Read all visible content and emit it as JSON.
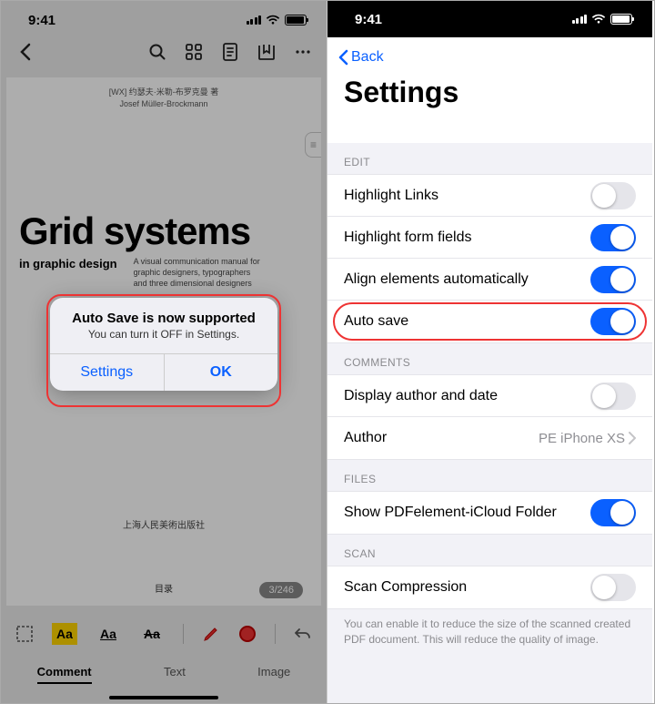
{
  "status_time": "9:41",
  "left": {
    "doc": {
      "meta_line1": "[WX] 约瑟夫·米勒-布罗克曼 著",
      "meta_line2": "Josef Müller-Brockmann",
      "title": "Grid systems",
      "subtitle": "in graphic design",
      "desc": "A visual communication manual for graphic designers, typographers and three dimensional designers",
      "footer": "上海人民美術出版社",
      "toc": "目录",
      "page_indicator": "3/246"
    },
    "tools": {
      "aa": "Aa"
    },
    "tabs": {
      "comment": "Comment",
      "text": "Text",
      "image": "Image"
    },
    "dialog": {
      "title": "Auto Save is now supported",
      "message": "You can turn it OFF in Settings.",
      "settings": "Settings",
      "ok": "OK"
    }
  },
  "right": {
    "back": "Back",
    "title": "Settings",
    "sections": {
      "edit": "EDIT",
      "comments": "COMMENTS",
      "files": "FILES",
      "scan": "SCAN"
    },
    "rows": {
      "highlight_links": "Highlight Links",
      "highlight_form": "Highlight form fields",
      "align": "Align elements automatically",
      "auto_save": "Auto save",
      "display_author": "Display author and date",
      "author": "Author",
      "author_value": "PE iPhone XS",
      "show_icloud": "Show PDFelement-iCloud Folder",
      "scan_compression": "Scan Compression"
    },
    "hint": "You can enable it to reduce the size of the scanned created PDF document. This will reduce the quality of image."
  }
}
